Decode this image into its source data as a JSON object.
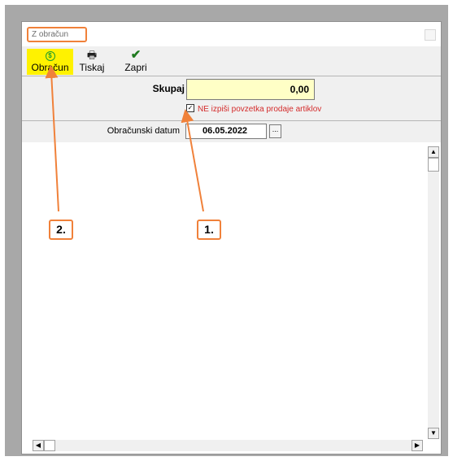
{
  "window": {
    "title": "Z obračun"
  },
  "toolbar": {
    "obracun_label": "Obračun",
    "tiskaj_label": "Tiskaj",
    "zapri_label": "Zapri",
    "obracun_icon": "$",
    "tiskaj_icon": "🖶",
    "zapri_icon": "✔"
  },
  "summary": {
    "skupaj_label": "Skupaj",
    "skupaj_value": "0,00",
    "checkbox_checked": true,
    "checkbox_mark": "✓",
    "checkbox_label": "NE izpiši povzetka prodaje artiklov"
  },
  "date": {
    "label": "Obračunski datum",
    "value": "06.05.2022",
    "picker_label": "..."
  },
  "scroll": {
    "up": "▲",
    "down": "▼",
    "left": "◀",
    "right": "▶"
  },
  "annotations": {
    "one": "1.",
    "two": "2."
  },
  "colors": {
    "highlight": "#fff200",
    "annotation": "#f0813a",
    "total_bg": "#ffffc6"
  }
}
